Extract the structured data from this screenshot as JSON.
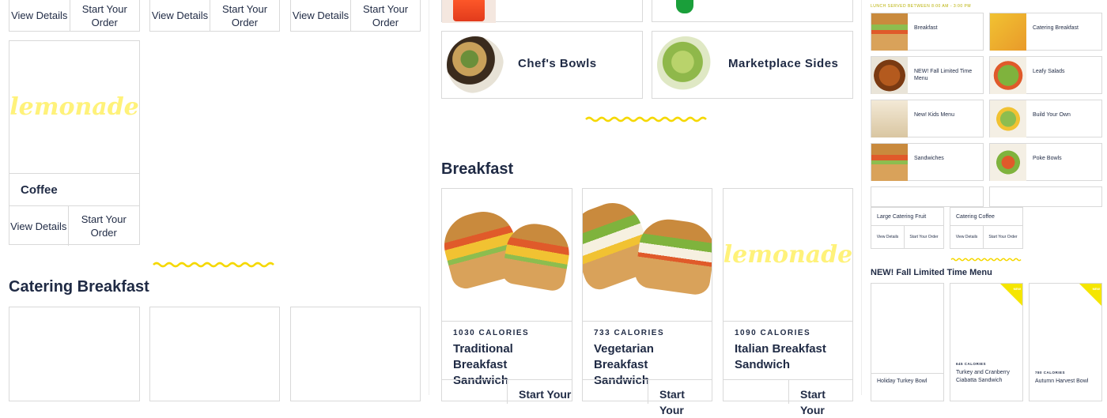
{
  "colors": {
    "accent": "#fff27a",
    "text": "#1f2a44",
    "border": "#d9d9d9"
  },
  "col1": {
    "top_buttons": [
      {
        "details": "View Details",
        "order": "Start Your Order"
      },
      {
        "details": "View Details",
        "order": "Start Your Order"
      },
      {
        "details": "View Details",
        "order": "Start Your Order"
      }
    ],
    "coffee": {
      "logo": "lemonade",
      "name": "Coffee",
      "details": "View Details",
      "order": "Start Your Order"
    },
    "section_title": "Catering Breakfast"
  },
  "col2": {
    "categories": [
      {
        "name": "Chef's Bowls"
      },
      {
        "name": "Marketplace Sides"
      }
    ],
    "section_title": "Breakfast",
    "products": [
      {
        "calories": "1030 CALORIES",
        "name": "Traditional Breakfast Sandwich",
        "order": "Start Your"
      },
      {
        "calories": "733 CALORIES",
        "name": "Vegetarian Breakfast Sandwich",
        "order": "Start Your"
      },
      {
        "calories": "1090 CALORIES",
        "name": "Italian Breakfast Sandwich",
        "logo": "lemonade",
        "order": "Start Your"
      }
    ]
  },
  "col3": {
    "lunch_note": "LUNCH SERVED BETWEEN 8:00 AM - 3:00 PM",
    "menu_items": [
      {
        "label": "Breakfast"
      },
      {
        "label": "Catering Breakfast"
      },
      {
        "label": "NEW! Fall Limited Time Menu"
      },
      {
        "label": "Leafy Salads"
      },
      {
        "label": "New! Kids Menu"
      },
      {
        "label": "Build Your Own"
      },
      {
        "label": "Sandwiches"
      },
      {
        "label": "Poke Bowls"
      }
    ],
    "small_cards": [
      {
        "name": "Large Catering Fruit",
        "details": "View Details",
        "order": "Start Your Order"
      },
      {
        "name": "Catering Coffee",
        "details": "View Details",
        "order": "Start Your Order"
      }
    ],
    "section_title": "NEW! Fall Limited Time Menu",
    "fall_items": [
      {
        "name": "Holiday Turkey Bowl",
        "calories": "",
        "badge": ""
      },
      {
        "name": "Turkey and Cranberry Ciabatta Sandwich",
        "calories": "645 CALORIES",
        "badge": "NEW"
      },
      {
        "name": "Autumn Harvest Bowl",
        "calories": "780 CALORIES",
        "badge": "NEW"
      }
    ]
  }
}
